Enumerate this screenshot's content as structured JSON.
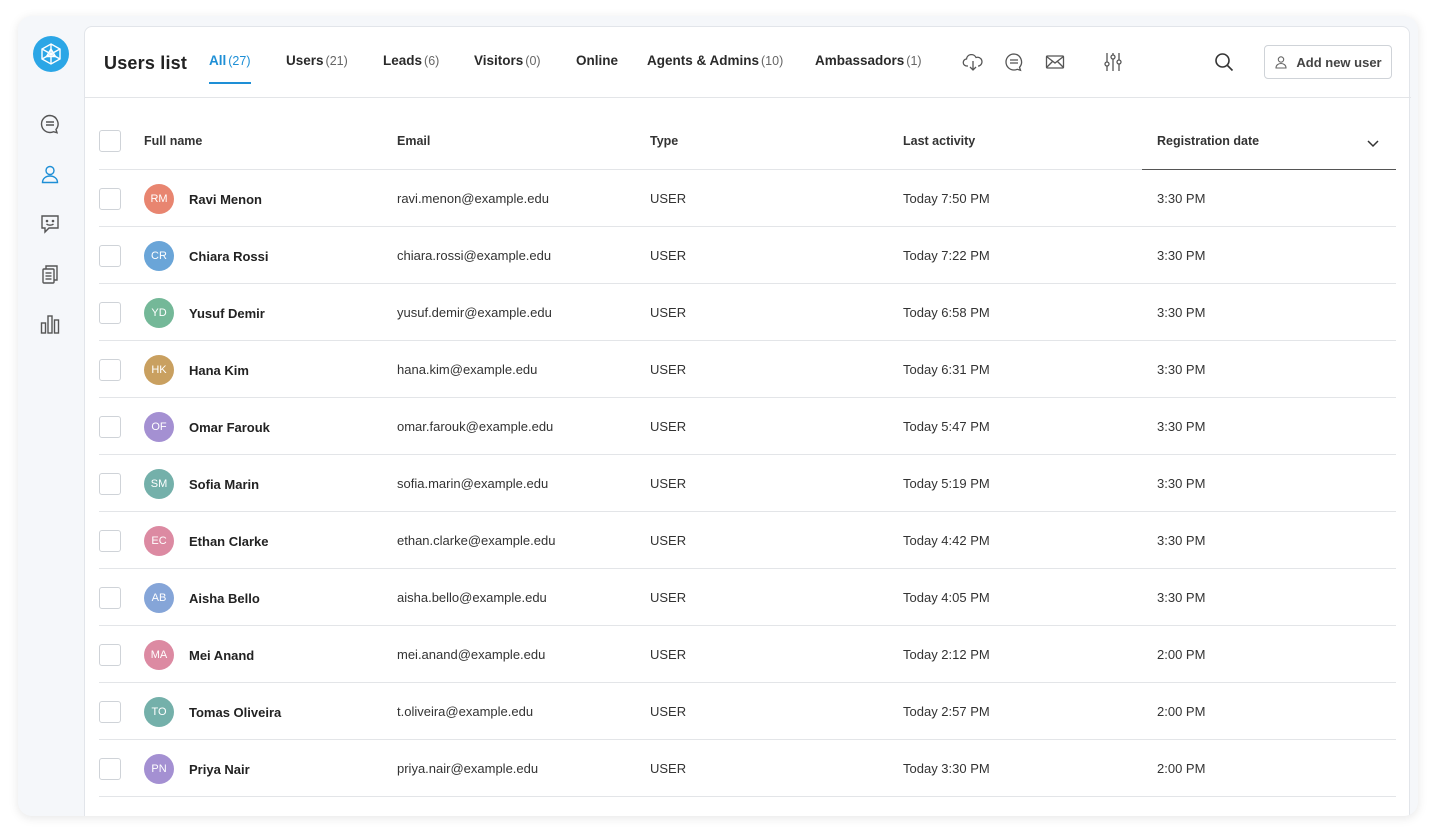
{
  "header": {
    "title": "Users list",
    "add_button_label": "Add new user"
  },
  "tabs": [
    {
      "label": "All",
      "count": "(27)",
      "active": true
    },
    {
      "label": "Users",
      "count": "(21)"
    },
    {
      "label": "Leads",
      "count": "(6)"
    },
    {
      "label": "Visitors",
      "count": "(0)"
    },
    {
      "label": "Online",
      "count": ""
    },
    {
      "label": "Agents & Admins",
      "count": "(10)"
    },
    {
      "label": "Ambassadors",
      "count": "(1)"
    }
  ],
  "icons": {
    "logo": "app-logo-icon",
    "sidebar": [
      "chat-bubble-icon",
      "user-icon",
      "smiley-chat-icon",
      "documents-icon",
      "bar-chart-icon"
    ],
    "toolbar": [
      "cloud-download-icon",
      "chat-bubble-icon",
      "envelope-icon",
      "sliders-icon",
      "search-icon"
    ]
  },
  "colors": {
    "accent": "#1e8fd6",
    "logo": "#2ba6e6"
  },
  "table": {
    "columns": [
      "Full name",
      "Email",
      "Type",
      "Last activity",
      "Registration date"
    ],
    "sorted_column": "Registration date",
    "rows": [
      {
        "initials": "RM",
        "name": "Ravi Menon",
        "email": "ravi.menon@example.edu",
        "type": "USER",
        "last_activity": "Today 7:50 PM",
        "registered": "3:30 PM",
        "avatar_color": "#e88570"
      },
      {
        "initials": "CR",
        "name": "Chiara Rossi",
        "email": "chiara.rossi@example.edu",
        "type": "USER",
        "last_activity": "Today 7:22 PM",
        "registered": "3:30 PM",
        "avatar_color": "#6aa5d8"
      },
      {
        "initials": "YD",
        "name": "Yusuf Demir",
        "email": "yusuf.demir@example.edu",
        "type": "USER",
        "last_activity": "Today 6:58 PM",
        "registered": "3:30 PM",
        "avatar_color": "#74b898"
      },
      {
        "initials": "HK",
        "name": "Hana Kim",
        "email": "hana.kim@example.edu",
        "type": "USER",
        "last_activity": "Today 6:31 PM",
        "registered": "3:30 PM",
        "avatar_color": "#c9a060"
      },
      {
        "initials": "OF",
        "name": "Omar Farouk",
        "email": "omar.farouk@example.edu",
        "type": "USER",
        "last_activity": "Today 5:47 PM",
        "registered": "3:30 PM",
        "avatar_color": "#a490d2"
      },
      {
        "initials": "SM",
        "name": "Sofia Marin",
        "email": "sofia.marin@example.edu",
        "type": "USER",
        "last_activity": "Today 5:19 PM",
        "registered": "3:30 PM",
        "avatar_color": "#74b0aa"
      },
      {
        "initials": "EC",
        "name": "Ethan Clarke",
        "email": "ethan.clarke@example.edu",
        "type": "USER",
        "last_activity": "Today 4:42 PM",
        "registered": "3:30 PM",
        "avatar_color": "#dc8aa2"
      },
      {
        "initials": "AB",
        "name": "Aisha Bello",
        "email": "aisha.bello@example.edu",
        "type": "USER",
        "last_activity": "Today 4:05 PM",
        "registered": "3:30 PM",
        "avatar_color": "#85a5d8"
      },
      {
        "initials": "MA",
        "name": "Mei Anand",
        "email": "mei.anand@example.edu",
        "type": "USER",
        "last_activity": "Today 2:12 PM",
        "registered": "2:00 PM",
        "avatar_color": "#dc8aa2"
      },
      {
        "initials": "TO",
        "name": "Tomas Oliveira",
        "email": "t.oliveira@example.edu",
        "type": "USER",
        "last_activity": "Today 2:57 PM",
        "registered": "2:00 PM",
        "avatar_color": "#74b0aa"
      },
      {
        "initials": "PN",
        "name": "Priya Nair",
        "email": "priya.nair@example.edu",
        "type": "USER",
        "last_activity": "Today 3:30 PM",
        "registered": "2:00 PM",
        "avatar_color": "#a490d2"
      }
    ]
  }
}
